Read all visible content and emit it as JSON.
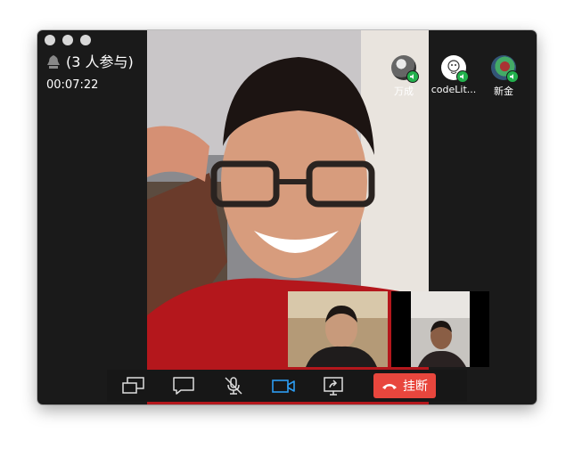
{
  "call": {
    "title": "(3 人参与)",
    "timer": "00:07:22"
  },
  "participants": [
    {
      "name": "万成",
      "icon": "avatar-photo"
    },
    {
      "name": "codeLit...",
      "icon": "avatar-cartoon"
    },
    {
      "name": "新金",
      "icon": "avatar-photo"
    }
  ],
  "toolbar": {
    "buttons": [
      "screen-share-icon",
      "chat-icon",
      "mic-muted-icon",
      "camera-icon",
      "share-screen-icon"
    ],
    "hangup_label": "挂断"
  },
  "colors": {
    "window_bg": "#1a1a1a",
    "active_camera": "#2c9cf2",
    "hangup": "#e8463d",
    "online_badge": "#23b14d"
  }
}
